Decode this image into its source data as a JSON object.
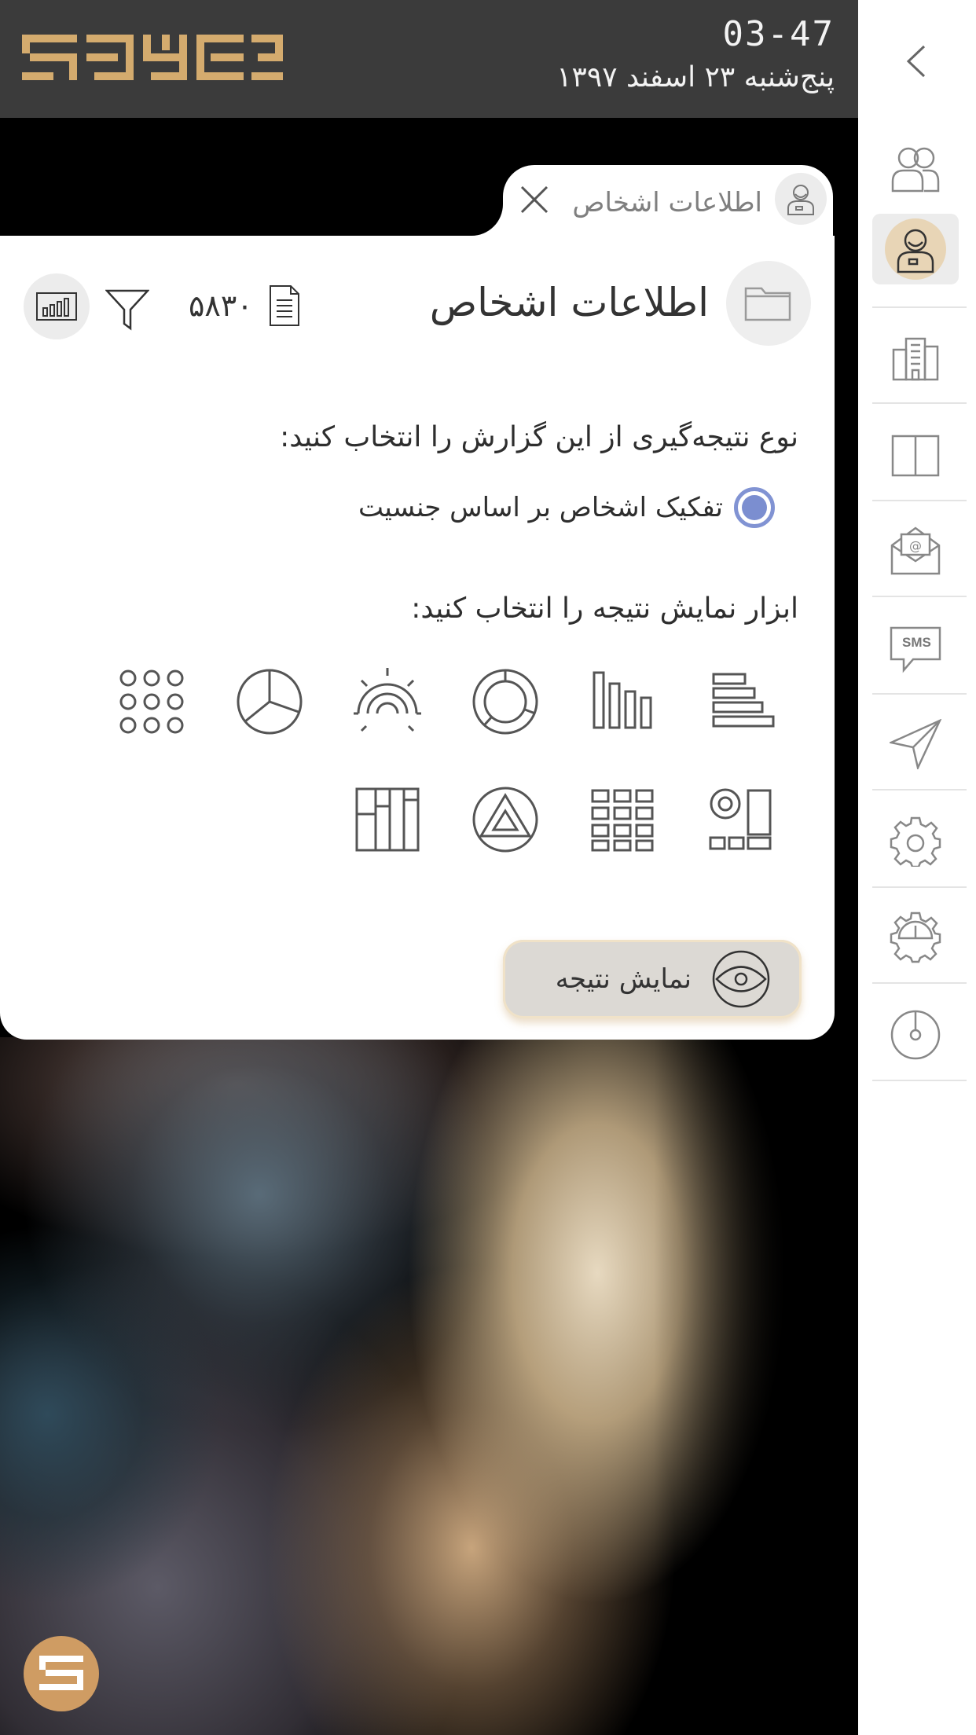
{
  "header": {
    "time": "03-47",
    "date": "پنج‌شنبه ۲۳ اسفند ۱۳۹۷"
  },
  "tab": {
    "label": "اطلاعات اشخاص"
  },
  "panel": {
    "title": "اطلاعات اشخاص",
    "record_count": "۵۸۳۰"
  },
  "report": {
    "question_type": "نوع نتیجه‌گیری از این گزارش را انتخاب کنید:",
    "option_label": "تفکیک اشخاص بر اساس جنسیت",
    "question_viz": "ابزار نمایش نتیجه را انتخاب کنید:",
    "viz_tools": [
      "horizontal-bar-chart-icon",
      "vertical-bar-chart-icon",
      "donut-chart-icon",
      "gauge-chart-icon",
      "pie-chart-icon",
      "dot-matrix-icon",
      "bubble-grid-icon",
      "table-grid-icon",
      "pyramid-chart-icon",
      "treemap-icon"
    ]
  },
  "actions": {
    "show_result": "نمایش نتیجه"
  },
  "sidebar": {
    "items": [
      "back-icon",
      "people-icon",
      "person-icon",
      "building-icon",
      "layout-icon",
      "email-icon",
      "sms-icon",
      "send-icon",
      "settings-icon",
      "gauge-settings-icon",
      "power-icon"
    ],
    "sms_text": "SMS"
  },
  "colors": {
    "accent_gold": "#cf9c63",
    "radio_blue": "#7b8ed0",
    "topbar": "#3b3b3b"
  }
}
